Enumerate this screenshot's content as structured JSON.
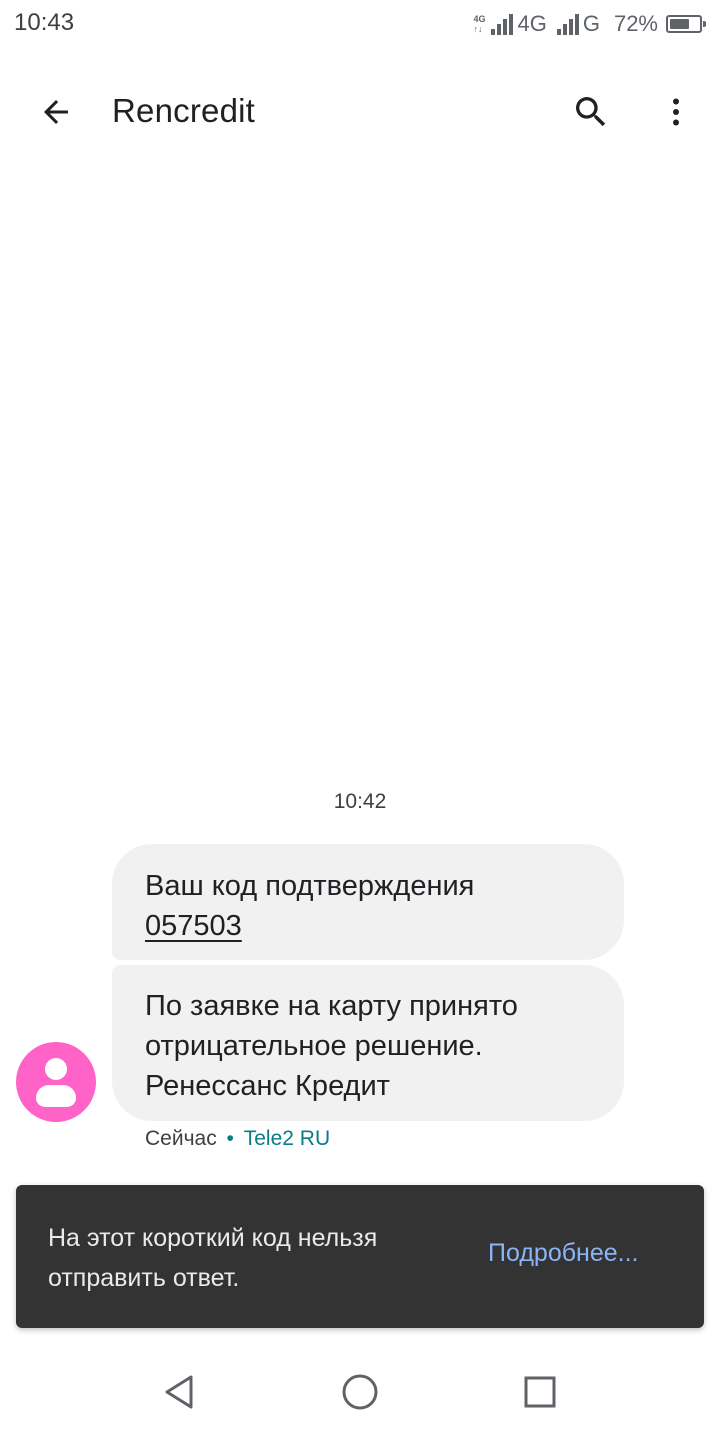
{
  "status_bar": {
    "time": "10:43",
    "network_small_top": "4G",
    "network_small_bottom": "↑↓",
    "network_1": "4G",
    "network_2": "G",
    "battery": "72%",
    "battery_level": 0.72
  },
  "app_bar": {
    "title": "Rencredit",
    "back_icon": "arrow-left-icon",
    "search_icon": "search-icon",
    "more_icon": "more-vert-icon"
  },
  "conversation": {
    "timestamp": "10:42",
    "messages": [
      {
        "text_prefix": "Ваш код подтверждения",
        "code": "057503"
      },
      {
        "text": "По заявке на карту принято отрицательное решение. Ренессанс Кредит"
      }
    ],
    "meta_time": "Сейчас",
    "meta_separator": "•",
    "meta_carrier": "Tele2 RU"
  },
  "snackbar": {
    "message": "На этот короткий код нельзя отправить ответ.",
    "action": "Подробнее..."
  },
  "colors": {
    "avatar": "#ff63c8",
    "bubble": "#f1f1f1",
    "snackbar_bg": "#333333",
    "snackbar_action": "#8ab4f8",
    "carrier": "#0b7b84"
  },
  "nav_bar": {
    "back_icon": "nav-back-triangle-icon",
    "home_icon": "nav-home-circle-icon",
    "recents_icon": "nav-recents-square-icon"
  }
}
